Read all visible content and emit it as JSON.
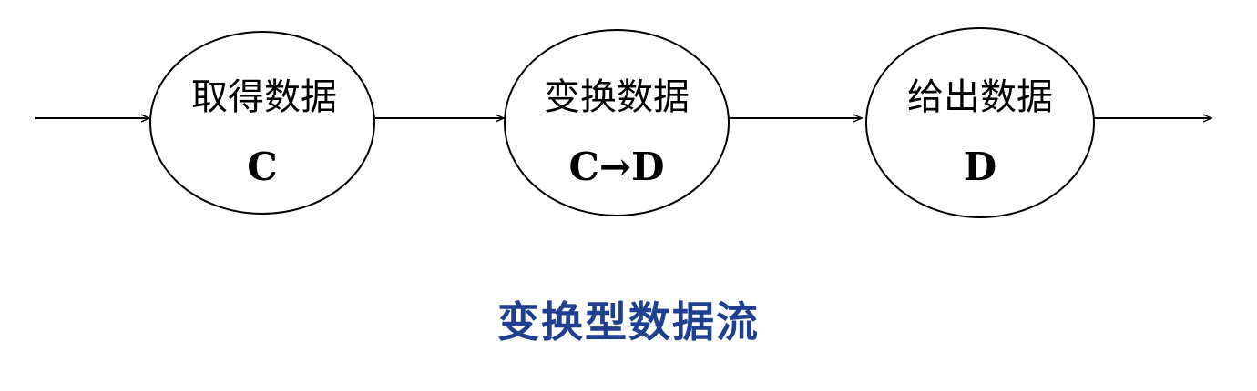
{
  "nodes": [
    {
      "title": "取得数据",
      "var": "C"
    },
    {
      "title": "变换数据",
      "var": "C→D"
    },
    {
      "title": "给出数据",
      "var": "D"
    }
  ],
  "caption": "变换型数据流",
  "colors": {
    "stroke": "#000000",
    "caption": "#1f3f8f"
  }
}
